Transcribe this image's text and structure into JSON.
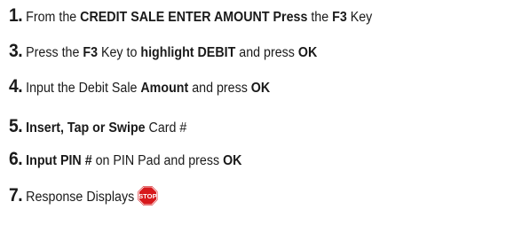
{
  "steps": [
    {
      "num": "1.",
      "segments": [
        {
          "t": " From the ",
          "b": false
        },
        {
          "t": "CREDIT SALE ENTER AMOUNT Press",
          "b": true
        },
        {
          "t": " the ",
          "b": false
        },
        {
          "t": "F3",
          "b": true
        },
        {
          "t": " Key",
          "b": false
        }
      ]
    },
    {
      "num": "3.",
      "segments": [
        {
          "t": " Press the ",
          "b": false
        },
        {
          "t": "F3",
          "b": true
        },
        {
          "t": " Key to ",
          "b": false
        },
        {
          "t": "highlight DEBIT",
          "b": true
        },
        {
          "t": " and press ",
          "b": false
        },
        {
          "t": "OK",
          "b": true
        }
      ]
    },
    {
      "num": "4.",
      "segments": [
        {
          "t": " Input the Debit Sale ",
          "b": false
        },
        {
          "t": "Amount",
          "b": true
        },
        {
          "t": " and press ",
          "b": false
        },
        {
          "t": "OK",
          "b": true
        }
      ]
    },
    {
      "num": "5.",
      "segments": [
        {
          "t": " Insert, Tap or Swipe",
          "b": true
        },
        {
          "t": " Card #",
          "b": false
        }
      ]
    },
    {
      "num": "6.",
      "segments": [
        {
          "t": "  Input PIN #",
          "b": true
        },
        {
          "t": " on PIN Pad and press ",
          "b": false
        },
        {
          "t": "OK",
          "b": true
        }
      ]
    },
    {
      "num": "7.",
      "segments": [
        {
          "t": " Response Displays",
          "b": false
        }
      ]
    }
  ],
  "stop_sign": {
    "icon": "stop-sign-icon",
    "text": "STOP",
    "color": "#d7191c"
  }
}
